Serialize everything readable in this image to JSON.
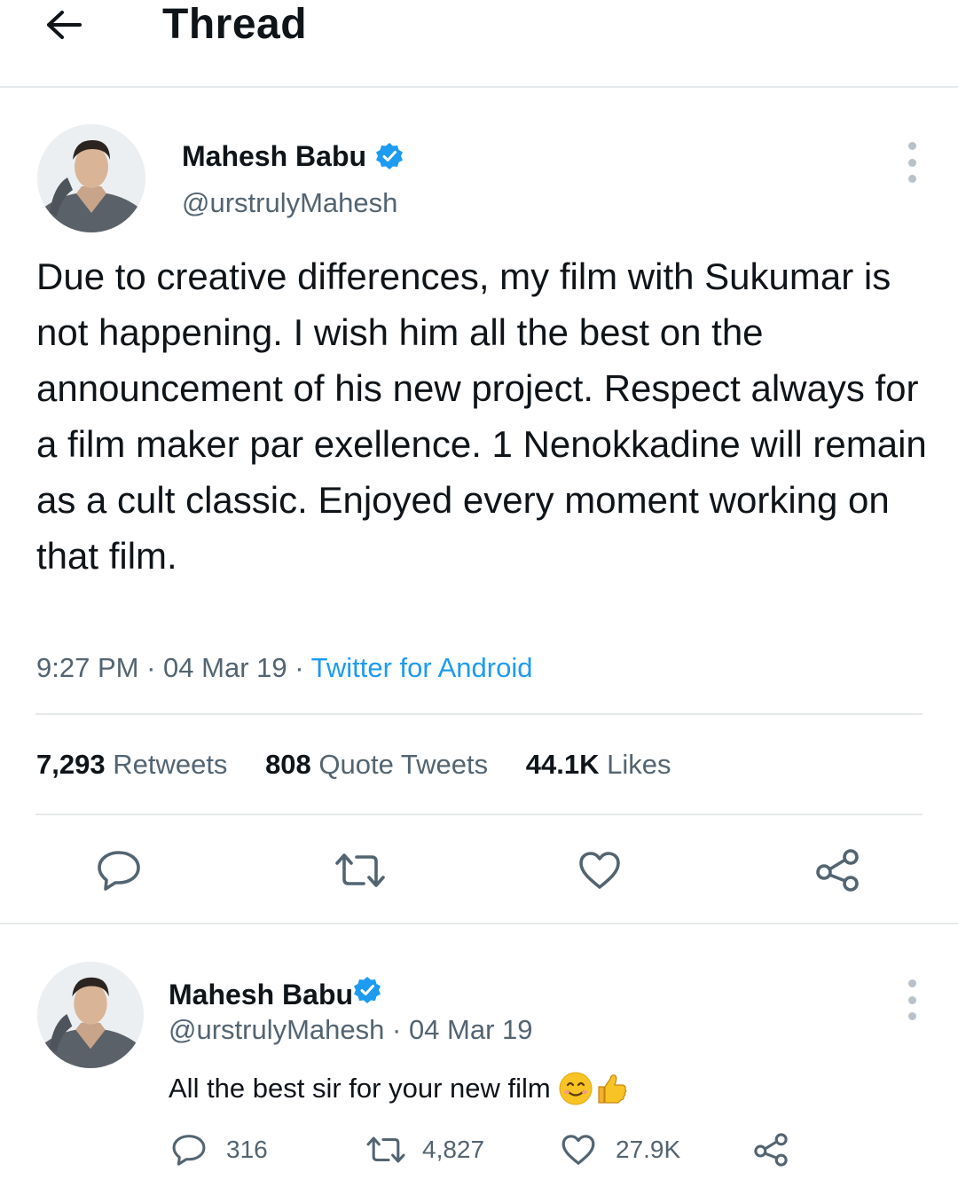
{
  "header": {
    "title": "Thread",
    "back_icon": "arrow-left-icon"
  },
  "tweet": {
    "author_name": "Mahesh Babu",
    "handle": "@urstrulyMahesh",
    "verified": true,
    "text": "Due to creative differences, my film with Sukumar is not happening. I wish him all the best on the announcement of his new project. Respect always for a film maker par exellence. 1 Nenokkadine will remain as a cult classic. Enjoyed every moment working on that film.",
    "time": "9:27 PM",
    "date": "04 Mar 19",
    "separator": "·",
    "source": "Twitter for Android",
    "stats": {
      "retweets_count": "7,293",
      "retweets_label": "Retweets",
      "quotes_count": "808",
      "quotes_label": "Quote Tweets",
      "likes_count": "44.1K",
      "likes_label": "Likes"
    },
    "actions": [
      "reply-icon",
      "retweet-icon",
      "like-icon",
      "share-icon"
    ]
  },
  "reply": {
    "author_name": "Mahesh Babu",
    "handle": "@urstrulyMahesh",
    "date_suffix": " · 04 Mar 19",
    "verified": true,
    "text": "All the best sir for your new film",
    "emojis": [
      "smiling-face-icon",
      "thumbs-up-icon"
    ],
    "counts": {
      "replies": "316",
      "retweets": "4,827",
      "likes": "27.9K"
    }
  },
  "colors": {
    "accent": "#1d9bf0",
    "text": "#0f1419",
    "secondary": "#536471",
    "divider": "#e6e9eb"
  }
}
